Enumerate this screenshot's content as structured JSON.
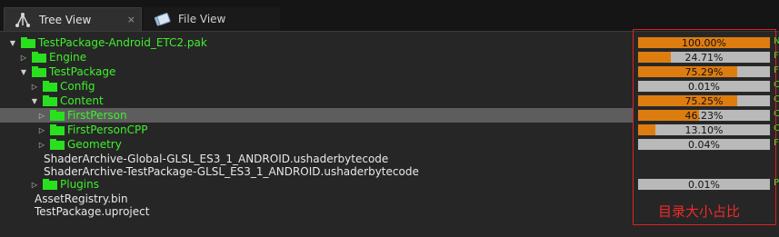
{
  "tabs": [
    {
      "label": "Tree View",
      "icon": "tree-icon",
      "close": "×"
    },
    {
      "label": "File View",
      "icon": "file-icon"
    }
  ],
  "tree": [
    {
      "label": "TestPackage-Android_ETC2.pak",
      "arrow": "▼",
      "folder": true,
      "pct": "100.00%",
      "value": 100.0,
      "side": "N"
    },
    {
      "label": "Engine",
      "arrow": "▷",
      "folder": true,
      "pct": "24.71%",
      "value": 24.71,
      "side": "F"
    },
    {
      "label": "TestPackage",
      "arrow": "▼",
      "folder": true,
      "pct": "75.29%",
      "value": 75.29,
      "side": "F"
    },
    {
      "label": "Config",
      "arrow": "▷",
      "folder": true,
      "pct": "0.01%",
      "value": 0.01,
      "side": "C"
    },
    {
      "label": "Content",
      "arrow": "▼",
      "folder": true,
      "pct": "75.25%",
      "value": 75.25,
      "side": "C"
    },
    {
      "label": "FirstPerson",
      "arrow": "▷",
      "folder": true,
      "pct": "46.23%",
      "value": 46.23,
      "side": "C",
      "selected": true
    },
    {
      "label": "FirstPersonCPP",
      "arrow": "▷",
      "folder": true,
      "pct": "13.10%",
      "value": 13.1,
      "side": "C"
    },
    {
      "label": "Geometry",
      "arrow": "▷",
      "folder": true,
      "pct": "0.04%",
      "value": 0.04,
      "side": "F"
    },
    {
      "label": "ShaderArchive-Global-GLSL_ES3_1_ANDROID.ushaderbytecode",
      "arrow": "",
      "folder": false
    },
    {
      "label": "ShaderArchive-TestPackage-GLSL_ES3_1_ANDROID.ushaderbytecode",
      "arrow": "",
      "folder": false
    },
    {
      "label": "Plugins",
      "arrow": "▷",
      "folder": true,
      "pct": "0.01%",
      "value": 0.01,
      "side": "P"
    },
    {
      "label": "AssetRegistry.bin",
      "arrow": "",
      "folder": false
    },
    {
      "label": "TestPackage.uproject",
      "arrow": "",
      "folder": false
    }
  ],
  "annotation": "目录大小占比",
  "colors": {
    "folder": "#29e01e",
    "label_green": "#3ef02c",
    "bar_fill": "#de7d0f",
    "bar_bg": "#b9b9b9",
    "highlight": "#e02020"
  }
}
